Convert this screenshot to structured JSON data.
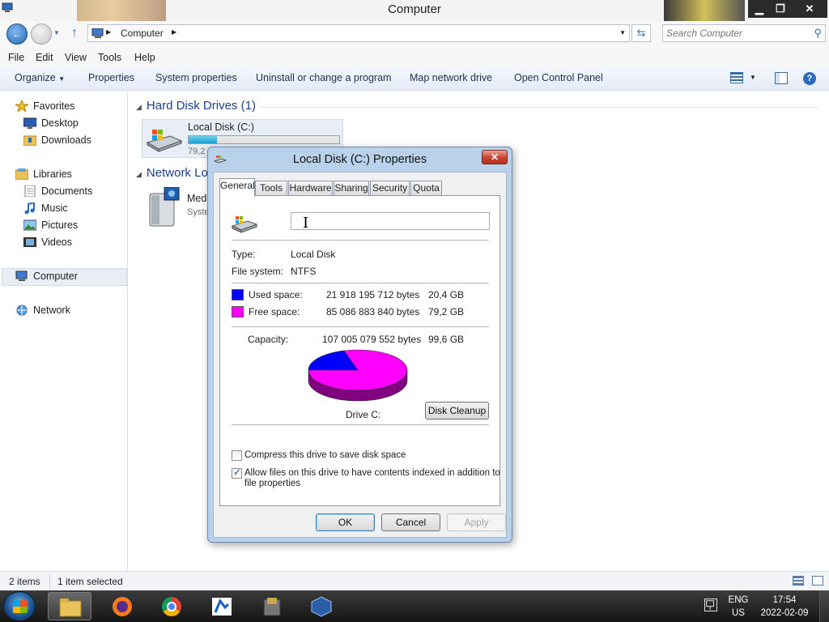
{
  "window": {
    "title": "Computer"
  },
  "address": {
    "crumb": "Computer",
    "search_placeholder": "Search Computer"
  },
  "menu": [
    "File",
    "Edit",
    "View",
    "Tools",
    "Help"
  ],
  "commands": [
    "Organize",
    "Properties",
    "System properties",
    "Uninstall or change a program",
    "Map network drive",
    "Open Control Panel"
  ],
  "nav": {
    "favorites": "Favorites",
    "desktop": "Desktop",
    "downloads": "Downloads",
    "libraries": "Libraries",
    "documents": "Documents",
    "music": "Music",
    "pictures": "Pictures",
    "videos": "Videos",
    "computer": "Computer",
    "network": "Network"
  },
  "content": {
    "hdd_header": "Hard Disk Drives (1)",
    "network_header": "Network Lo",
    "drive_name": "Local Disk (C:)",
    "drive_used_fraction": 0.19,
    "drive_free": "79,2",
    "media_name": "Med",
    "media_sub": "Syste"
  },
  "status": {
    "items": "2 items",
    "selected": "1 item selected"
  },
  "taskbar": {
    "apps": [
      "file-explorer",
      "firefox",
      "chrome",
      "app-blue",
      "app-archive",
      "virtualbox"
    ],
    "lang_top": "ENG",
    "lang_bottom": "US",
    "time": "17:54",
    "date": "2022-02-09"
  },
  "dialog": {
    "title": "Local Disk (C:) Properties",
    "tabs": [
      "General",
      "Tools",
      "Hardware",
      "Sharing",
      "Security",
      "Quota"
    ],
    "name_value": "",
    "type_label": "Type:",
    "type_value": "Local Disk",
    "fs_label": "File system:",
    "fs_value": "NTFS",
    "used_label": "Used space:",
    "used_bytes": "21 918 195 712 bytes",
    "used_gb": "20,4 GB",
    "free_label": "Free space:",
    "free_bytes": "85 086 883 840 bytes",
    "free_gb": "79,2 GB",
    "cap_label": "Capacity:",
    "cap_bytes": "107 005 079 552 bytes",
    "cap_gb": "99,6 GB",
    "drive_label": "Drive C:",
    "cleanup": "Disk Cleanup",
    "compress": "Compress this drive to save disk space",
    "index_line1": "Allow files on this drive to have contents indexed in addition to",
    "index_line2": "file properties",
    "ok": "OK",
    "cancel": "Cancel",
    "apply": "Apply",
    "used_fraction": 0.2048,
    "colors": {
      "used": "#0000ff",
      "free": "#ff00ff"
    }
  }
}
